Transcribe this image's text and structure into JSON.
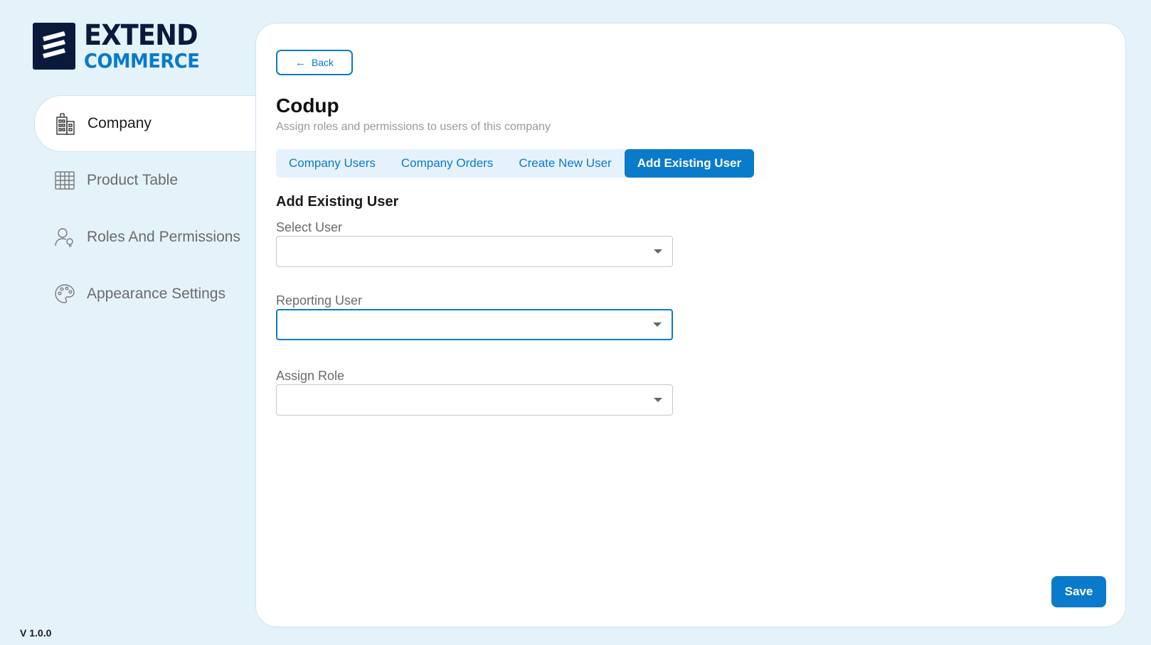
{
  "brand": {
    "line1": "EXTEND",
    "line2": "COMMERCE",
    "icon": "extend-commerce-logo"
  },
  "sidebar": {
    "items": [
      {
        "label": "Company",
        "icon": "building-icon",
        "active": true
      },
      {
        "label": "Product Table",
        "icon": "table-icon",
        "active": false
      },
      {
        "label": "Roles And Permissions",
        "icon": "user-key-icon",
        "active": false
      },
      {
        "label": "Appearance Settings",
        "icon": "palette-icon",
        "active": false
      }
    ]
  },
  "version": "V 1.0.0",
  "header": {
    "back_label": "Back",
    "title": "Codup",
    "subtitle": "Assign roles and permissions to users of this company"
  },
  "tabs": [
    {
      "label": "Company Users",
      "active": false
    },
    {
      "label": "Company Orders",
      "active": false
    },
    {
      "label": "Create New User",
      "active": false
    },
    {
      "label": "Add Existing User",
      "active": true
    }
  ],
  "form": {
    "section_title": "Add Existing User",
    "fields": [
      {
        "label": "Select User",
        "value": ""
      },
      {
        "label": "Reporting User",
        "value": ""
      },
      {
        "label": "Assign Role",
        "value": ""
      }
    ],
    "save_label": "Save"
  },
  "colors": {
    "accent": "#0a7acb",
    "brand_dark": "#0b1a3c",
    "background": "#e4f2fa"
  }
}
